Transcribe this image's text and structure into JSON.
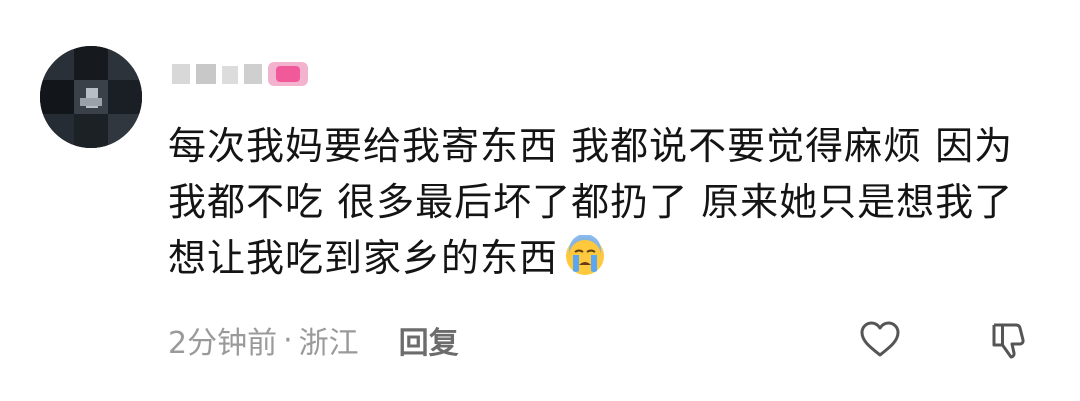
{
  "comment": {
    "author": {
      "avatar_icon": "avatar-icon",
      "name_visible": false
    },
    "lines": [
      "每次我妈要给我寄东西 我都说不要觉得麻烦 因为",
      "我都不吃 很多最后坏了都扔了 原来她只是想我了",
      "想让我吃到家乡的东西"
    ],
    "emoji": "crying-face-emoji",
    "time": "2分钟前",
    "separator": "·",
    "location": "浙江",
    "reply_label": "回复",
    "like_icon": "heart-icon",
    "dislike_icon": "thumbs-down-icon",
    "colors": {
      "text": "#141414",
      "meta": "#9a9a9a",
      "reply": "#6c6c6c",
      "icon": "#555555",
      "badge_pink": "#f05a9a"
    }
  }
}
